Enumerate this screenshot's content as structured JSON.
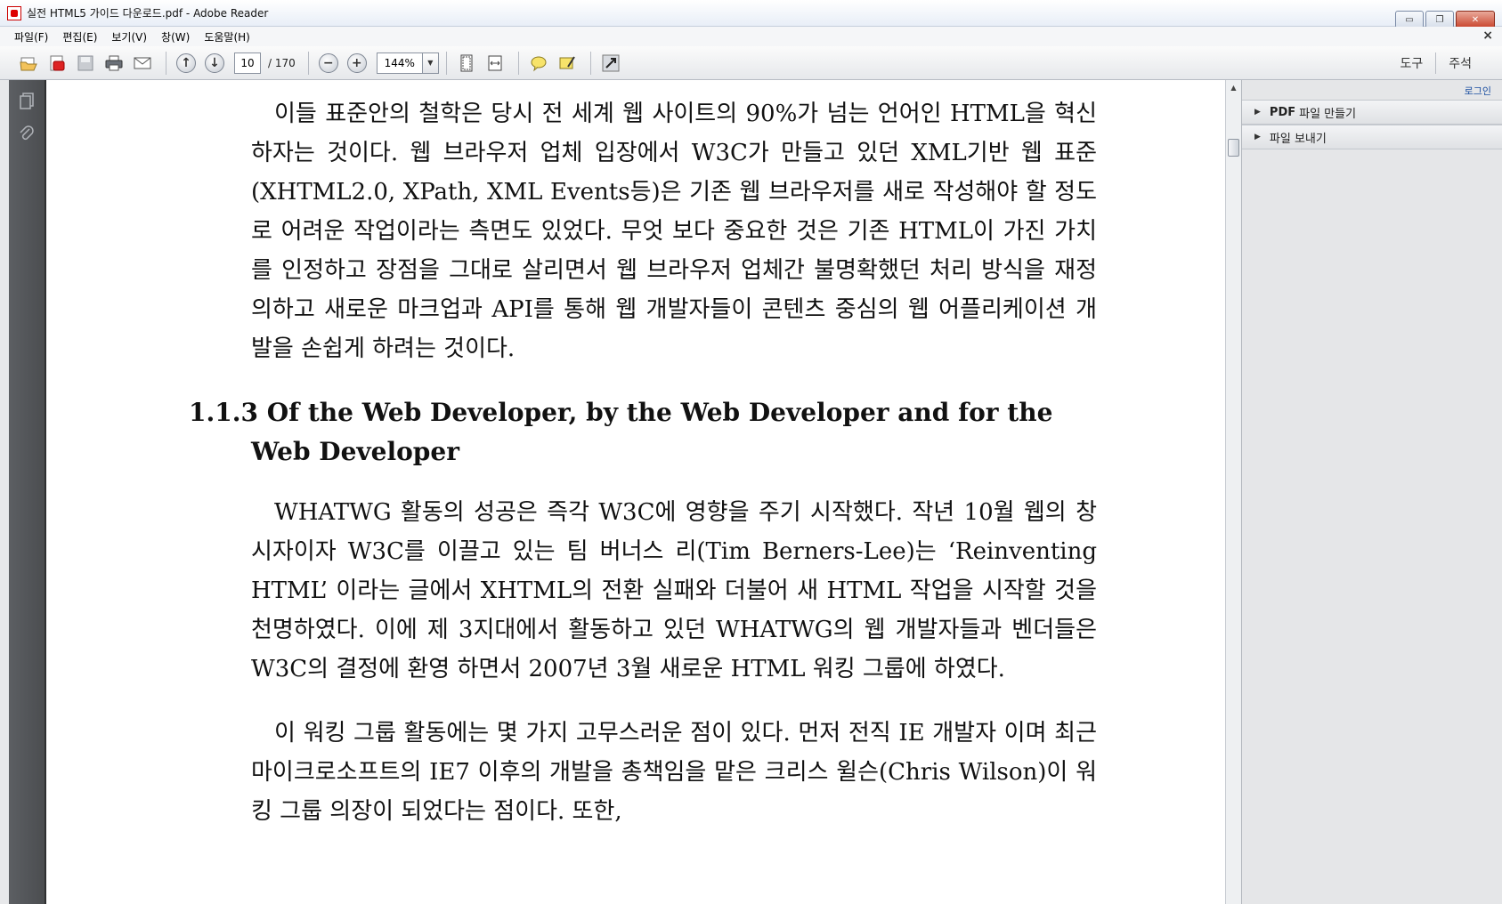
{
  "window": {
    "title": "실전 HTML5 가이드 다운로드.pdf - Adobe Reader",
    "minimize_glyph": "▭",
    "restore_glyph": "❐",
    "close_glyph": "✕"
  },
  "menu": {
    "items": [
      "파일(F)",
      "편집(E)",
      "보기(V)",
      "창(W)",
      "도움말(H)"
    ],
    "close_glyph": "×"
  },
  "toolbar": {
    "page_current": "10",
    "page_total": "/ 170",
    "zoom": "144%",
    "zoom_out_glyph": "−",
    "zoom_in_glyph": "+",
    "tools_label": "도구",
    "comment_label": "주석"
  },
  "taskpane": {
    "login": "로그인",
    "create_pdf_bold": "PDF",
    "create_pdf_rest": "파일 만들기",
    "send_file": "파일 보내기"
  },
  "document": {
    "para1": "이들 표준안의 철학은 당시 전 세계 웹 사이트의 90%가 넘는 언어인 HTML을 혁신하자는 것이다. 웹 브라우저 업체 입장에서 W3C가 만들고 있던 XML기반 웹 표준(XHTML2.0, XPath, XML Events등)은 기존 웹 브라우저를 새로 작성해야 할 정도로 어려운 작업이라는 측면도 있었다. 무엇 보다 중요한 것은 기존 HTML이 가진 가치를 인정하고 장점을 그대로 살리면서 웹 브라우저 업체간 불명확했던 처리 방식을 재정의하고 새로운 마크업과 API를 통해 웹 개발자들이 콘텐츠 중심의 웹 어플리케이션 개발을 손쉽게 하려는 것이다.",
    "heading": "1.1.3 Of the Web Developer, by the Web Developer and for the Web Developer",
    "para2": "WHATWG 활동의 성공은 즉각 W3C에 영향을 주기 시작했다. 작년 10월 웹의 창시자이자 W3C를 이끌고 있는 팀 버너스 리(Tim Berners-Lee)는 ‘Reinventing HTML’ 이라는 글에서 XHTML의 전환 실패와 더불어 새 HTML 작업을 시작할 것을 천명하였다. 이에 제 3지대에서 활동하고 있던 WHATWG의 웹 개발자들과 벤더들은 W3C의 결정에 환영 하면서 2007년 3월 새로운 HTML 워킹 그룹에 하였다.",
    "para3": "이 워킹 그룹 활동에는 몇 가지 고무스러운 점이 있다. 먼저 전직 IE 개발자 이며 최근 마이크로소프트의 IE7 이후의 개발을 총책임을 맡은 크리스 윌슨(Chris Wilson)이 워킹 그룹 의장이 되었다는 점이다. 또한,"
  },
  "colors": {
    "nav_pane": "#4b4d50",
    "page_bg": "#ffffff",
    "task_pane": "#e5e6e8",
    "link": "#1a4ea0"
  }
}
